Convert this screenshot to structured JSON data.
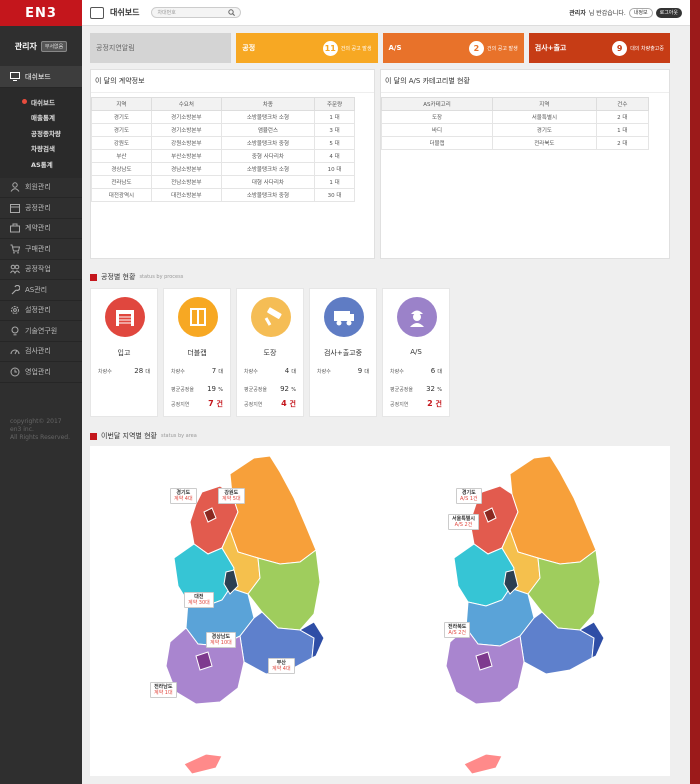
{
  "app": {
    "logo": "EN3",
    "user": "관리자",
    "user_tag": "부서없음"
  },
  "sidebar": {
    "items": [
      {
        "label": "대쉬보드",
        "icon": "monitor-icon"
      },
      {
        "label": "회원관리",
        "icon": "users-icon"
      },
      {
        "label": "공정관리",
        "icon": "calendar-icon"
      },
      {
        "label": "계약관리",
        "icon": "briefcase-icon"
      },
      {
        "label": "구매관리",
        "icon": "cart-icon"
      },
      {
        "label": "공정작업",
        "icon": "people-icon"
      },
      {
        "label": "AS관리",
        "icon": "wrench-icon"
      },
      {
        "label": "설정관리",
        "icon": "gear-icon"
      },
      {
        "label": "기술연구원",
        "icon": "bulb-icon"
      },
      {
        "label": "검사관리",
        "icon": "gauge-icon"
      },
      {
        "label": "영업관리",
        "icon": "clock-icon"
      }
    ],
    "sub": [
      {
        "label": "대쉬보드",
        "color": "#e84c3d"
      },
      {
        "label": "매출통계"
      },
      {
        "label": "공정종차량"
      },
      {
        "label": "차량검색"
      },
      {
        "label": "AS통계"
      }
    ],
    "copyright": [
      "copyright© 2017",
      "en3 inc.",
      "All Rights Reserved."
    ]
  },
  "topbar": {
    "title": "대쉬보드",
    "search_placeholder": "차대번호",
    "greeting_name": "관리자",
    "greeting_text": "님 반갑습니다.",
    "btn_info": "내정보",
    "btn_logout": "로그아웃"
  },
  "stats": [
    {
      "name": "공정지연알림",
      "color": "#d4d4d4",
      "text": "#666"
    },
    {
      "name": "공정",
      "num": "11",
      "label": "건의 공고 발생",
      "color": "#f7a823"
    },
    {
      "name": "A/S",
      "num": "2",
      "label": "건의 공고 발생",
      "color": "#e8722a"
    },
    {
      "name": "검사+출고",
      "num": "9",
      "label": "대의 차량출고중",
      "color": "#c63c15"
    }
  ],
  "contracts": {
    "title": "이 달의 계약정보",
    "headers": [
      "지역",
      "수요처",
      "차종",
      "주문량"
    ],
    "rows": [
      [
        "경기도",
        "경기소방본부",
        "소방물탱크차 소형",
        "1 대"
      ],
      [
        "경기도",
        "경기소방본부",
        "앰뷸런스",
        "3 대"
      ],
      [
        "강원도",
        "강원소방본부",
        "소방물탱크차 중형",
        "5 대"
      ],
      [
        "부산",
        "부산소방본부",
        "중형 사다리차",
        "4 대"
      ],
      [
        "경상남도",
        "경남소방본부",
        "소방물탱크차 소형",
        "10 대"
      ],
      [
        "전라남도",
        "전남소방본부",
        "대형 사다리차",
        "1 대"
      ],
      [
        "대전광역시",
        "대전소방본부",
        "소방물탱크차 중형",
        "30 대"
      ]
    ]
  },
  "as_category": {
    "title": "이 달의 A/S 카테고리별 현황",
    "headers": [
      "AS카테고리",
      "지역",
      "건수"
    ],
    "rows": [
      [
        "도장",
        "서울특별시",
        "2 대"
      ],
      [
        "바디",
        "경기도",
        "1 대"
      ],
      [
        "더블캡",
        "전라북도",
        "2 대"
      ]
    ]
  },
  "process": {
    "title": "공정별 현황",
    "subtitle": "status by process",
    "cards": [
      {
        "name": "입고",
        "color": "#e0473e",
        "icon": "garage-icon",
        "vehicles": "28",
        "unit": "대"
      },
      {
        "name": "더블캡",
        "color": "#f7a823",
        "icon": "door-icon",
        "vehicles": "7",
        "unit": "대",
        "avg_label": "평균공정율",
        "avg": "19",
        "delay_label": "공정지연",
        "delay": "7"
      },
      {
        "name": "도장",
        "color": "#f5bd55",
        "icon": "roller-icon",
        "vehicles": "4",
        "unit": "대",
        "avg_label": "평균공정율",
        "avg": "92",
        "delay_label": "공정지연",
        "delay": "4"
      },
      {
        "name": "검사+출고중",
        "color": "#5f7cc4",
        "icon": "truck-icon",
        "vehicles": "9",
        "unit": "대"
      },
      {
        "name": "A/S",
        "color": "#9b82c9",
        "icon": "worker-icon",
        "vehicles": "6",
        "unit": "대",
        "avg_label": "평균공정율",
        "avg": "32",
        "delay_label": "공정지연",
        "delay": "2"
      }
    ],
    "vehicles_label": "차량수",
    "pct": "%",
    "cnt": "건"
  },
  "region": {
    "title": "이번달 지역별 현황",
    "subtitle": "status by area",
    "left_labels": [
      {
        "t": "경기도",
        "s": "계약 4대"
      },
      {
        "t": "강원도",
        "s": "계약 5대"
      },
      {
        "t": "대전",
        "s": "계약 30대"
      },
      {
        "t": "경상남도",
        "s": "계약 10대"
      },
      {
        "t": "부산",
        "s": "계약 4대"
      },
      {
        "t": "전라남도",
        "s": "계약 1대"
      }
    ],
    "right_labels": [
      {
        "t": "경기도",
        "s": "A/S 1건"
      },
      {
        "t": "서울특별시",
        "s": "A/S 2건"
      },
      {
        "t": "전라북도",
        "s": "A/S 2건"
      }
    ]
  }
}
